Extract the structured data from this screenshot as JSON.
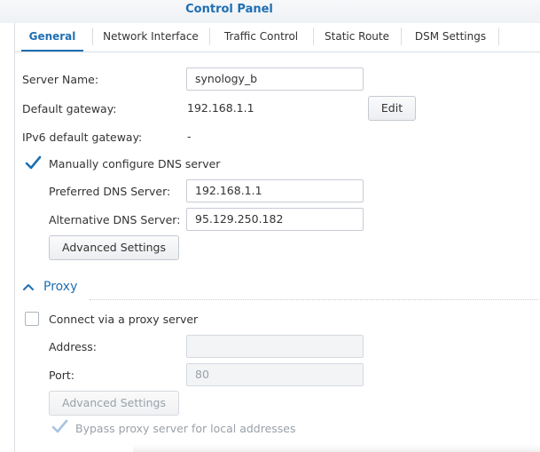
{
  "window": {
    "title": "Control Panel"
  },
  "tabs": [
    {
      "label": "General",
      "active": true
    },
    {
      "label": "Network Interface",
      "active": false
    },
    {
      "label": "Traffic Control",
      "active": false
    },
    {
      "label": "Static Route",
      "active": false
    },
    {
      "label": "DSM Settings",
      "active": false
    }
  ],
  "general": {
    "server_name_label": "Server Name:",
    "server_name_value": "synology_b",
    "gateway_label": "Default gateway:",
    "gateway_value": "192.168.1.1",
    "edit_label": "Edit",
    "ipv6_label": "IPv6 default gateway:",
    "ipv6_value": "-",
    "dns_checkbox_label": "Manually configure DNS server",
    "dns_checked": true,
    "preferred_dns_label": "Preferred DNS Server:",
    "preferred_dns_value": "192.168.1.1",
    "alt_dns_label": "Alternative DNS Server:",
    "alt_dns_value": "95.129.250.182",
    "advanced_label": "Advanced Settings"
  },
  "proxy": {
    "section_title": "Proxy",
    "connect_label": "Connect via a proxy server",
    "connect_checked": false,
    "address_label": "Address:",
    "address_value": "",
    "port_label": "Port:",
    "port_value": "80",
    "advanced_label": "Advanced Settings",
    "bypass_label": "Bypass proxy server for local addresses",
    "bypass_checked": true
  },
  "colors": {
    "accent": "#1f6fb2",
    "text": "#333333",
    "disabled_text": "#9aa1a9",
    "border": "#c7ccd3"
  }
}
